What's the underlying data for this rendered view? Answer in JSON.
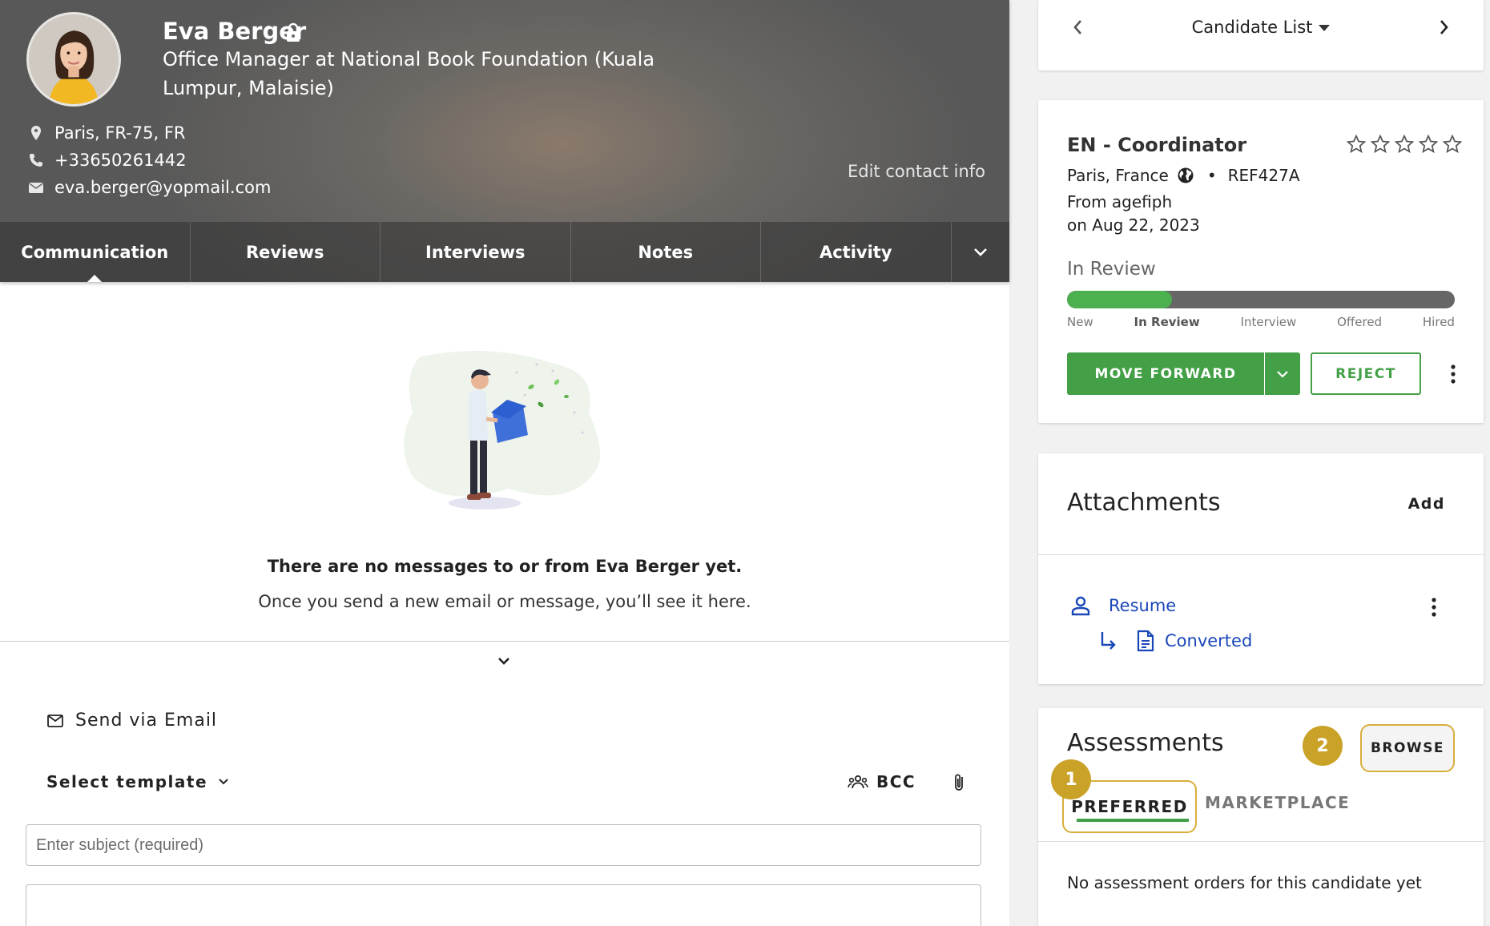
{
  "candidate": {
    "name": "Eva Berger",
    "title": "Office Manager at National Book Foundation (Kuala Lumpur, Malaisie)",
    "location": "Paris, FR-75, FR",
    "phone": "+33650261442",
    "email": "eva.berger@yopmail.com",
    "edit_contact_label": "Edit contact info"
  },
  "tabs": [
    {
      "label": "Communication",
      "active": true
    },
    {
      "label": "Reviews"
    },
    {
      "label": "Interviews"
    },
    {
      "label": "Notes"
    },
    {
      "label": "Activity"
    }
  ],
  "communication": {
    "empty_title": "There are no messages to or from Eva Berger yet.",
    "empty_subtitle": "Once you send a new email or message, you’ll see it here.",
    "send_via": "Send via Email",
    "select_template": "Select template",
    "bcc": "BCC",
    "subject_placeholder": "Enter subject (required)"
  },
  "nav": {
    "candidate_list": "Candidate List"
  },
  "job": {
    "title": "EN - Coordinator",
    "location": "Paris, France",
    "ref": "REF427A",
    "from": "From agefiph",
    "date": "on Aug 22, 2023",
    "stage": "In Review",
    "stage_progress": 0.27,
    "steps": [
      "New",
      "In Review",
      "Interview",
      "Offered",
      "Hired"
    ],
    "current_step": 1,
    "rating_max": 5,
    "rating": 0,
    "move_forward": "MOVE FORWARD",
    "reject": "REJECT",
    "accent_color": "#43a047"
  },
  "attachments": {
    "title": "Attachments",
    "add": "Add",
    "resume": "Resume",
    "converted": "Converted",
    "link_color": "#1a47b8"
  },
  "assessments": {
    "title": "Assessments",
    "browse": "BROWSE",
    "tab_preferred": "PREFERRED",
    "tab_marketplace": "MARKETPLACE",
    "empty": "No assessment orders for this candidate yet",
    "badge_1": "1",
    "badge_2": "2",
    "highlight_color": "#c9a227"
  }
}
